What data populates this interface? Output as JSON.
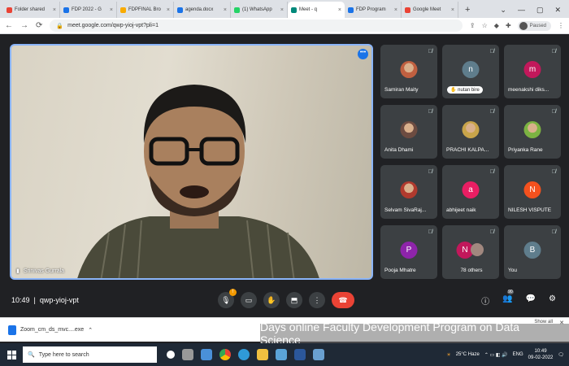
{
  "browser": {
    "tabs": [
      {
        "label": "Folder shared",
        "color": "#ea4335"
      },
      {
        "label": "FDP 2022 - G",
        "color": "#1a73e8"
      },
      {
        "label": "FDPFINAL Bro",
        "color": "#f9ab00"
      },
      {
        "label": "agenda.docx",
        "color": "#1a73e8"
      },
      {
        "label": "(1) WhatsApp",
        "color": "#25d366"
      },
      {
        "label": "Meet - q",
        "color": "#00897b",
        "active": true
      },
      {
        "label": "FDP Program",
        "color": "#1a73e8"
      },
      {
        "label": "Google Meet",
        "color": "#ea4335"
      }
    ],
    "new_tab": "+",
    "url": "meet.google.com/qwp-yioj-vpt?pli=1",
    "profile_status": "Paused"
  },
  "meet": {
    "main_speaker": "Srinivas Gurrala",
    "participants": [
      {
        "name": "Samiran Maity",
        "initial": "",
        "color": "#c06040",
        "photo": true
      },
      {
        "name": "nutan bire",
        "initial": "n",
        "color": "#5f7d8c",
        "chip": true
      },
      {
        "name": "meenakshi diks...",
        "initial": "m",
        "color": "#c2185b"
      },
      {
        "name": "Anita Dhami",
        "initial": "",
        "color": "#6d4c41",
        "photo": true
      },
      {
        "name": "PRACHI KALPA...",
        "initial": "",
        "color": "#c8a44a",
        "photo": true
      },
      {
        "name": "Priyanka Rane",
        "initial": "",
        "color": "#7cb342",
        "photo": true
      },
      {
        "name": "Selvam SivaRaj...",
        "initial": "",
        "color": "#b03a2e",
        "photo": true
      },
      {
        "name": "abhijeet naik",
        "initial": "a",
        "color": "#e91e63"
      },
      {
        "name": "NILESH VISPUTE",
        "initial": "N",
        "color": "#f4511e"
      },
      {
        "name": "Pooja Mhatre",
        "initial": "P",
        "color": "#8e24aa"
      },
      {
        "name": "78 others",
        "initial": "N",
        "color": "#c2185b",
        "others": true
      },
      {
        "name": "You",
        "initial": "B",
        "color": "#5f7d8c"
      }
    ],
    "time": "10:49",
    "meeting_code": "qwp-yioj-vpt",
    "people_count": "90"
  },
  "download": {
    "file": "Zoom_cm_ds_mvc....exe",
    "show_all": "Show all"
  },
  "banner": "Days online Faculty Development Program on Data Science",
  "taskbar": {
    "search_placeholder": "Type here to search",
    "weather": "25°C  Haze",
    "lang": "ENG",
    "time": "10:49",
    "date": "09-02-2022"
  }
}
